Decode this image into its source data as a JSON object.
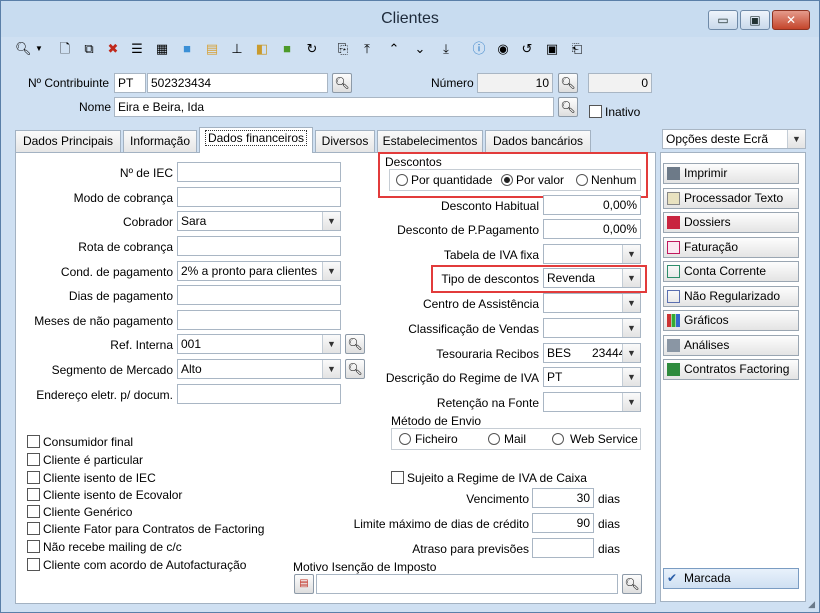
{
  "window": {
    "title": "Clientes",
    "minimize_glyph": "▭",
    "maximize_glyph": "▣",
    "close_glyph": "✕"
  },
  "toolbar": {
    "icons": [
      "search-icon",
      "dropdown-icon",
      "new-doc-icon",
      "copy-doc-icon",
      "delete-icon",
      "list-view-icon",
      "table-icon",
      "folder-icon",
      "folder-doc-icon",
      "hierarchy-icon",
      "folder-search-icon",
      "folder-green-icon",
      "refresh-icon",
      "preview-icon",
      "first-record-icon",
      "previous-record-icon",
      "next-record-icon",
      "last-record-icon",
      "help-icon",
      "info-icon",
      "sync-icon",
      "settings-monitor-icon",
      "attachment-icon"
    ]
  },
  "header": {
    "contribuinte_label": "Nº Contribuinte",
    "contribuinte_country": "PT",
    "contribuinte_value": "502323434",
    "numero_label": "Número",
    "numero_value": "10",
    "numero_extra": "0",
    "nome_label": "Nome",
    "nome_value": "Eira e Beira, Ida",
    "inativo_label": "Inativo"
  },
  "tabs": [
    {
      "label": "Dados Principais"
    },
    {
      "label": "Informação"
    },
    {
      "label": "Dados financeiros"
    },
    {
      "label": "Diversos"
    },
    {
      "label": "Estabelecimentos"
    },
    {
      "label": "Dados bancários"
    }
  ],
  "left_form": {
    "iec_label": "Nº de IEC",
    "iec_value": "",
    "modo_cobranca_label": "Modo de cobrança",
    "cobrador_label": "Cobrador",
    "cobrador_value": "Sara",
    "rota_label": "Rota de cobrança",
    "cond_pagamento_label": "Cond. de pagamento",
    "cond_pagamento_value": "2% a pronto para clientes",
    "dias_pagamento_label": "Dias de pagamento",
    "meses_nao_pagamento_label": "Meses de não pagamento",
    "ref_interna_label": "Ref. Interna",
    "ref_interna_value": "001",
    "segmento_label": "Segmento de Mercado",
    "segmento_value": "Alto",
    "endereco_label": "Endereço eletr. p/ docum."
  },
  "checkboxes": [
    {
      "label": "Consumidor final"
    },
    {
      "label": "Cliente é particular"
    },
    {
      "label": "Cliente isento de IEC"
    },
    {
      "label": "Cliente isento de Ecovalor"
    },
    {
      "label": "Cliente Genérico"
    },
    {
      "label": "Cliente Fator para Contratos de Factoring"
    },
    {
      "label": "Não recebe mailing de c/c"
    },
    {
      "label": "Cliente com acordo de  Autofacturação"
    }
  ],
  "descontos": {
    "title": "Descontos",
    "options": [
      "Por quantidade",
      "Por valor",
      "Nenhum"
    ],
    "selected": "Por valor"
  },
  "right_form": {
    "desconto_habitual_label": "Desconto Habitual",
    "desconto_habitual_value": "0,00%",
    "desconto_ppag_label": "Desconto de P.Pagamento",
    "desconto_ppag_value": "0,00%",
    "tabela_iva_label": "Tabela de IVA fixa",
    "tipo_descontos_label": "Tipo de descontos",
    "tipo_descontos_value": "Revenda",
    "centro_assistencia_label": "Centro de Assistência",
    "classificacao_label": "Classificação de Vendas",
    "tesouraria_label": "Tesouraria Recibos",
    "tesouraria_value": "BES",
    "tesouraria_value2": "23444",
    "regime_iva_label": "Descrição do Regime de IVA",
    "regime_iva_value": "PT",
    "retencao_label": "Retenção na Fonte",
    "metodo_envio_label": "Método de Envio",
    "metodo_envio_options": [
      "Ficheiro",
      "Mail",
      "Web Service"
    ],
    "regime_iva_caixa_label": "Sujeito a Regime de IVA de Caixa",
    "vencimento_label": "Vencimento",
    "vencimento_value": "30",
    "limite_dias_label": "Limite máximo de dias de crédito",
    "limite_dias_value": "90",
    "atraso_label": "Atraso para previsões",
    "atraso_value": "",
    "dias_unit": "dias",
    "motivo_isencao_label": "Motivo Isenção de Imposto"
  },
  "side_panel": {
    "combo_label": "Opções deste Ecrã",
    "buttons": [
      {
        "label": "Imprimir",
        "icon": "printer-icon"
      },
      {
        "label": "Processador Texto",
        "icon": "word-processor-icon"
      },
      {
        "label": "Dossiers",
        "icon": "dossier-icon"
      },
      {
        "label": "Faturação",
        "icon": "invoice-icon"
      },
      {
        "label": "Conta Corrente",
        "icon": "account-icon"
      },
      {
        "label": "Não Regularizado",
        "icon": "unsettled-icon"
      },
      {
        "label": "Gráficos",
        "icon": "chart-icon"
      },
      {
        "label": "Análises",
        "icon": "analysis-icon"
      },
      {
        "label": "Contratos Factoring",
        "icon": "contract-icon"
      }
    ],
    "marcada_label": "Marcada"
  },
  "colors": {
    "highlight_box": "#e23b3b",
    "window_frame": "#cfe0f2"
  }
}
